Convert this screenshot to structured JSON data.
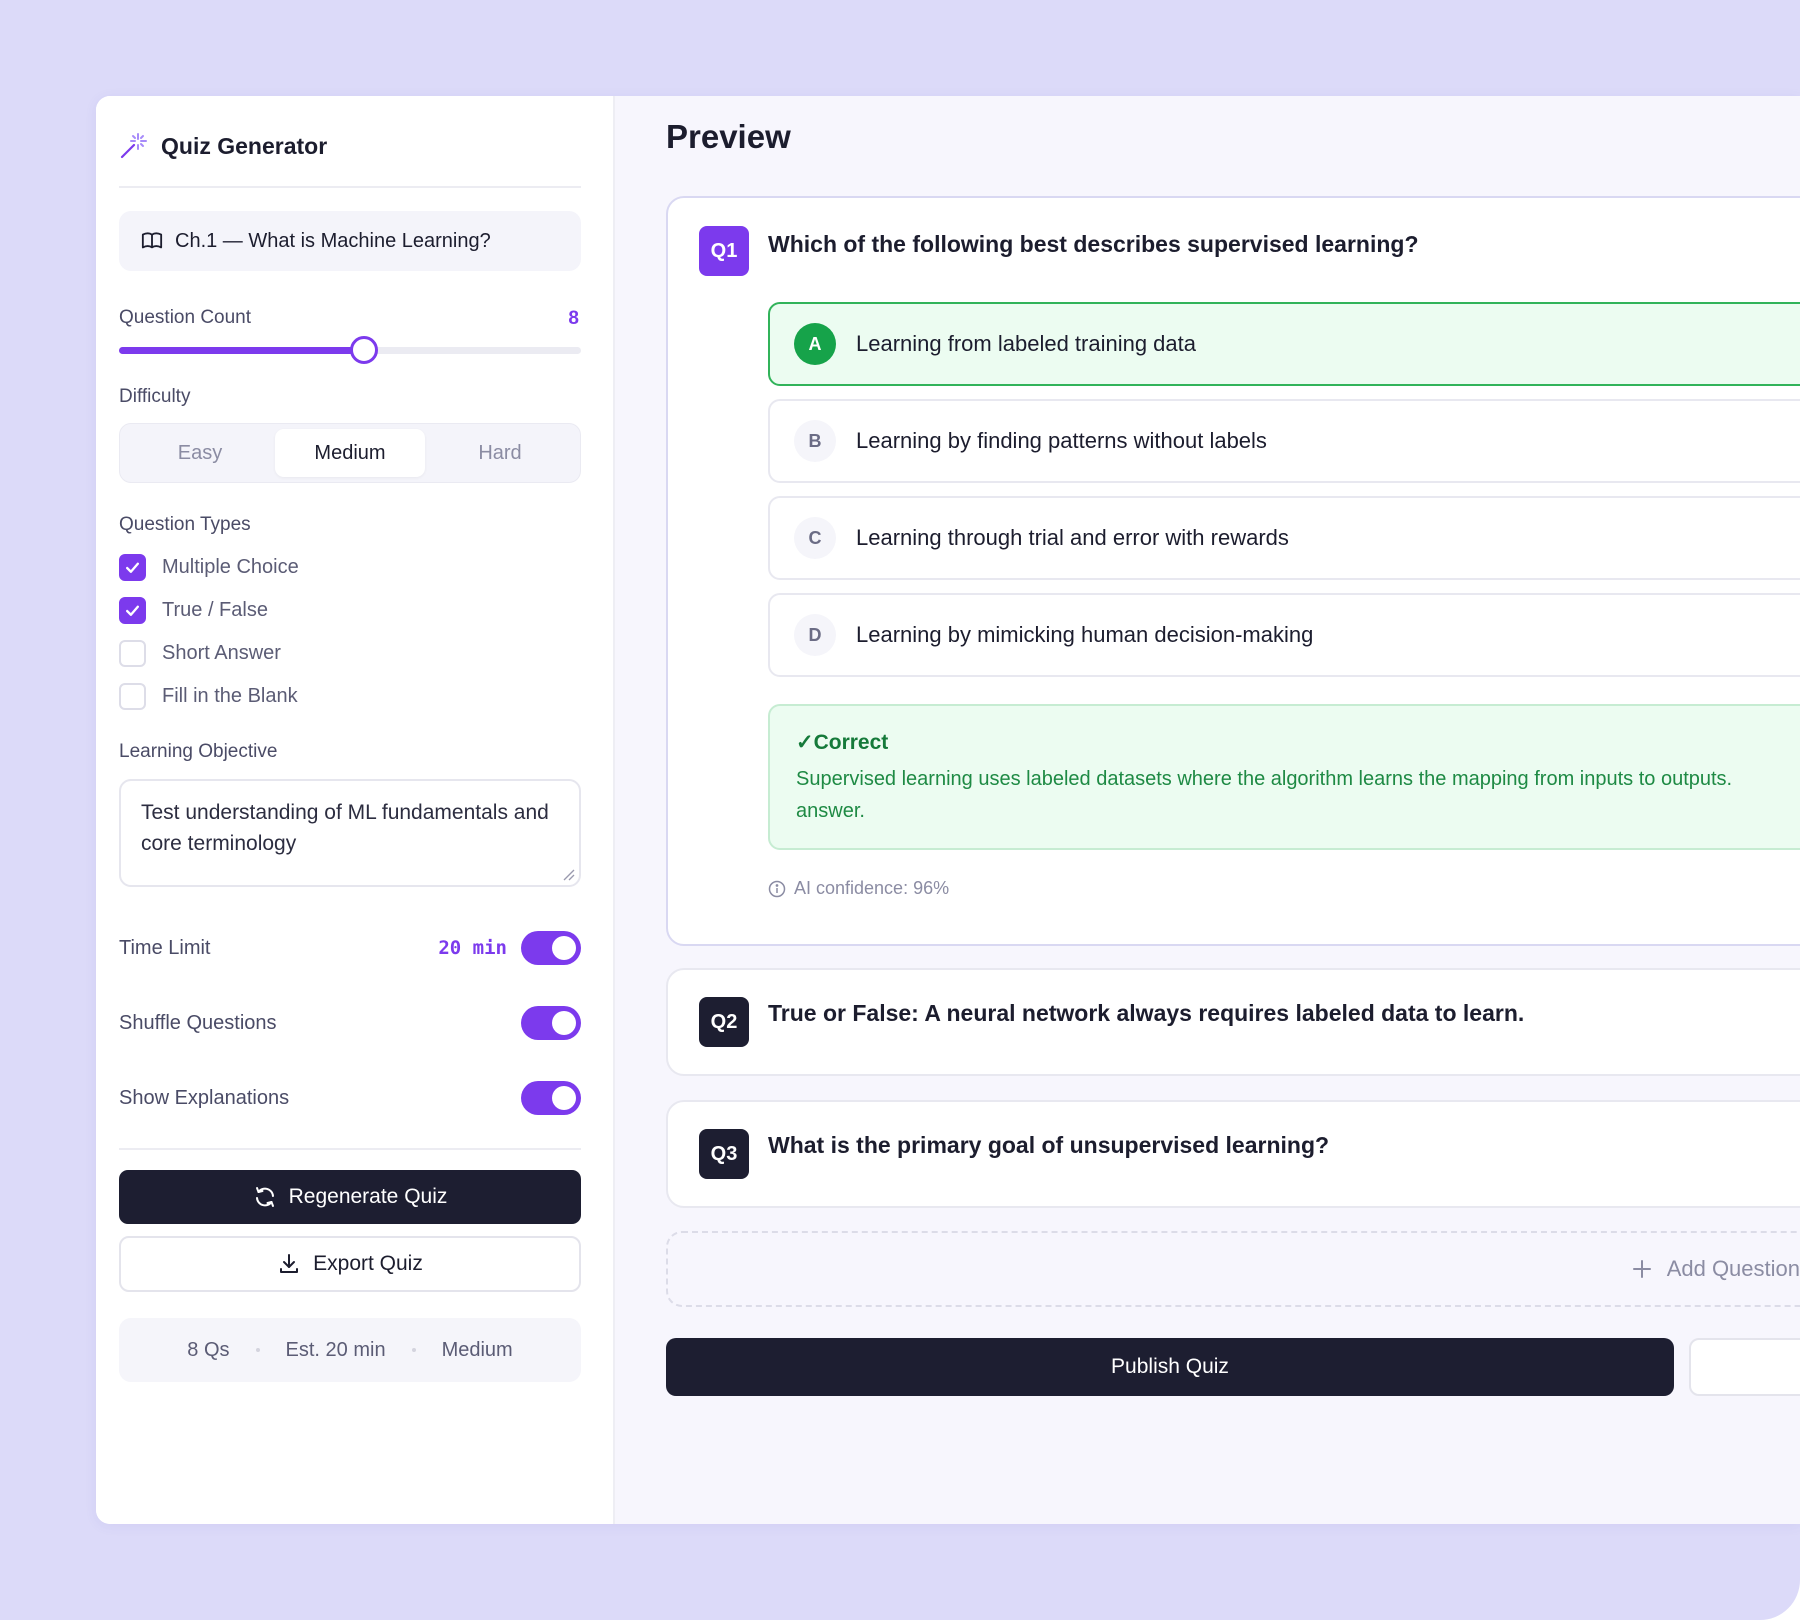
{
  "sidebar": {
    "title": "Quiz Generator",
    "chapter": "Ch.1 — What is Machine Learning?",
    "question_count_label": "Question Count",
    "question_count_value": "8",
    "question_count_fraction": 0.53,
    "difficulty_label": "Difficulty",
    "difficulty_options": [
      "Easy",
      "Medium",
      "Hard"
    ],
    "difficulty_selected": "Medium",
    "question_types_label": "Question Types",
    "question_types": [
      {
        "label": "Multiple Choice",
        "checked": true
      },
      {
        "label": "True / False",
        "checked": true
      },
      {
        "label": "Short Answer",
        "checked": false
      },
      {
        "label": "Fill in the Blank",
        "checked": false
      }
    ],
    "objective_label": "Learning Objective",
    "objective_text": "Test understanding of ML fundamentals and core terminology",
    "time_limit_label": "Time Limit",
    "time_limit_value": "20 min",
    "time_limit_on": true,
    "shuffle_label": "Shuffle Questions",
    "shuffle_on": true,
    "explanations_label": "Show Explanations",
    "explanations_on": true,
    "regenerate_label": "Regenerate Quiz",
    "export_label": "Export Quiz",
    "summary": [
      "8 Qs",
      "Est. 20 min",
      "Medium"
    ]
  },
  "main": {
    "title": "Preview",
    "questions": [
      {
        "badge": "Q1",
        "text": "Which of the following best describes supervised learning?",
        "options": [
          {
            "letter": "A",
            "text": "Learning from labeled training data",
            "correct": true
          },
          {
            "letter": "B",
            "text": "Learning by finding patterns without labels",
            "correct": false
          },
          {
            "letter": "C",
            "text": "Learning through trial and error with rewards",
            "correct": false
          },
          {
            "letter": "D",
            "text": "Learning by mimicking human decision-making",
            "correct": false
          }
        ],
        "feedback_title": "✓Correct",
        "feedback_line1": "Supervised learning uses labeled datasets where the algorithm learns the mapping from inputs to outputs.",
        "feedback_line2": "answer.",
        "confidence": "AI confidence: 96%"
      },
      {
        "badge": "Q2",
        "text": "True or False: A neural network always requires labeled data to learn."
      },
      {
        "badge": "Q3",
        "text": "What is the primary goal of unsupervised learning?"
      }
    ],
    "add_question_label": "Add Question",
    "publish_label": "Publish Quiz"
  },
  "colors": {
    "accent": "#7c3aed",
    "dark": "#1d1e31",
    "correct": "#16a34a",
    "background": "#dcdaf9"
  }
}
